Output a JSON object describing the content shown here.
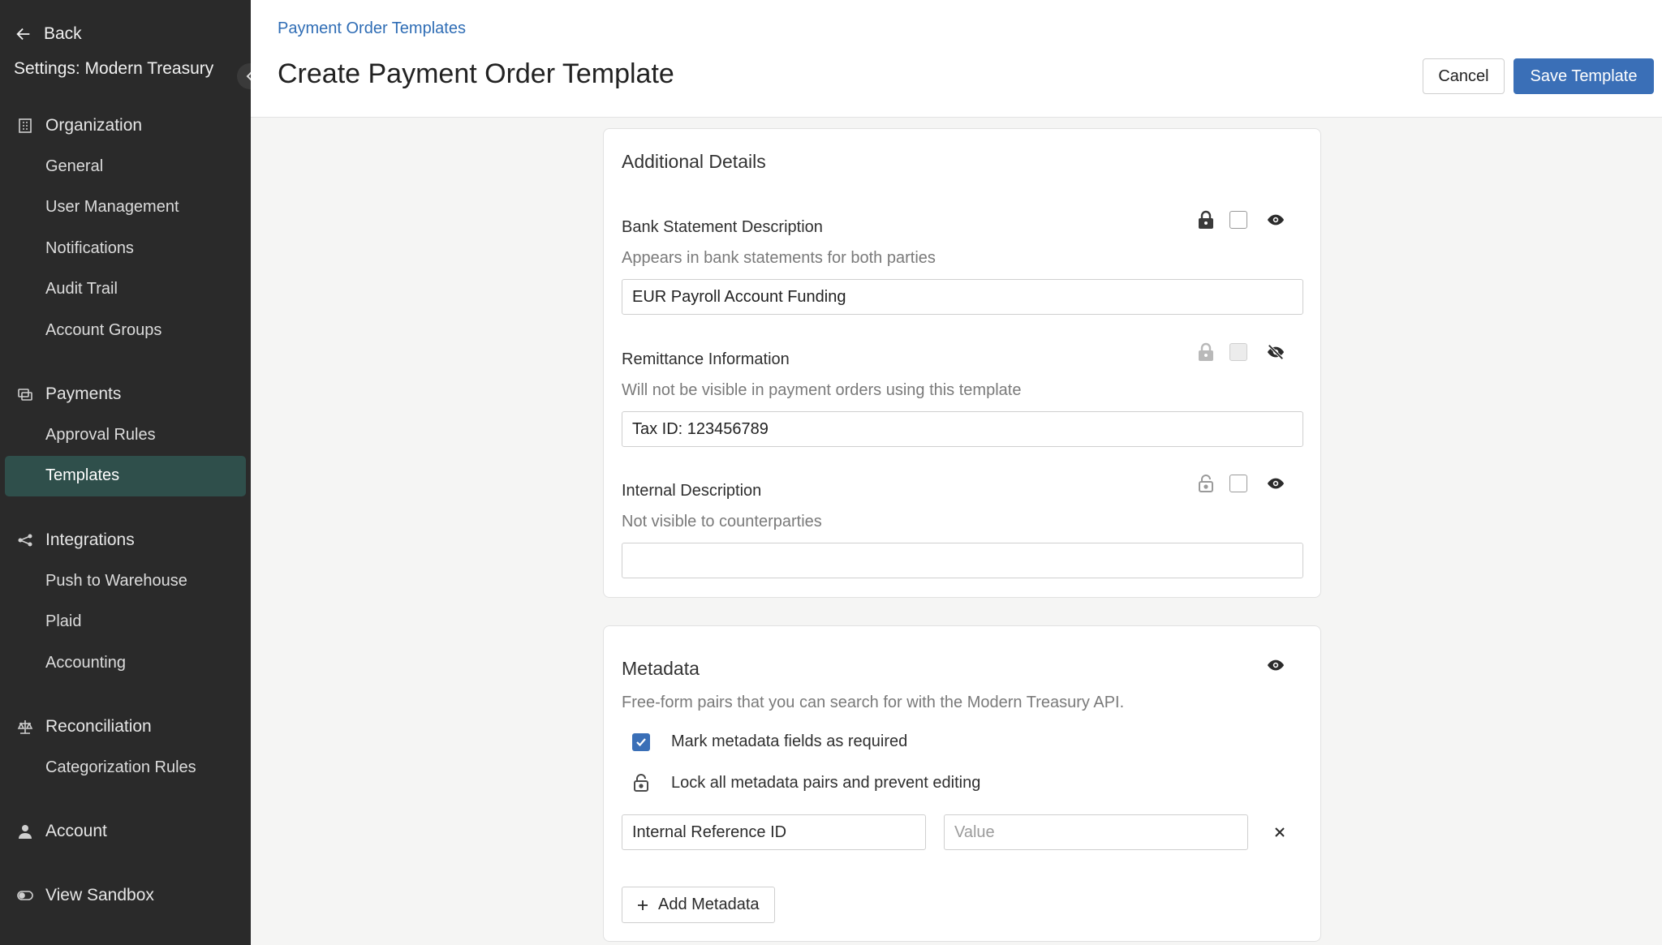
{
  "sidebar": {
    "back_label": "Back",
    "org_title": "Settings: Modern Treasury",
    "sections": {
      "organization": {
        "label": "Organization",
        "items": [
          "General",
          "User Management",
          "Notifications",
          "Audit Trail",
          "Account Groups"
        ]
      },
      "payments": {
        "label": "Payments",
        "items": [
          "Approval Rules",
          "Templates"
        ]
      },
      "integrations": {
        "label": "Integrations",
        "items": [
          "Push to Warehouse",
          "Plaid",
          "Accounting"
        ]
      },
      "reconciliation": {
        "label": "Reconciliation",
        "items": [
          "Categorization Rules"
        ]
      },
      "account": {
        "label": "Account"
      },
      "sandbox": {
        "label": "View Sandbox"
      }
    },
    "active_item": "Templates",
    "active_color": "#2f4f4b"
  },
  "header": {
    "breadcrumb": "Payment Order Templates",
    "title": "Create Payment Order Template",
    "cancel_label": "Cancel",
    "save_label": "Save Template",
    "primary_color": "#3a6fb7"
  },
  "additional_details": {
    "title": "Additional Details",
    "fields": [
      {
        "label": "Bank Statement Description",
        "help": "Appears in bank statements for both parties",
        "value": "EUR Payroll Account Funding",
        "lock_icon": "lock-icon",
        "visibility_icon": "eye-icon",
        "checked": false
      },
      {
        "label": "Remittance Information",
        "help": "Will not be visible in payment orders using this template",
        "value": "Tax ID: 123456789",
        "lock_icon": "lock-icon",
        "visibility_icon": "eye-off-icon",
        "checked": false,
        "disabled": true
      },
      {
        "label": "Internal Description",
        "help": "Not visible to counterparties",
        "value": "",
        "lock_icon": "lock-open-icon",
        "visibility_icon": "eye-icon",
        "checked": false
      }
    ]
  },
  "metadata": {
    "title": "Metadata",
    "help": "Free-form pairs that you can search for with the Modern Treasury API.",
    "required_label": "Mark metadata fields as required",
    "required_checked": true,
    "lock_label": "Lock all metadata pairs and prevent editing",
    "pair_key": "Internal Reference ID",
    "pair_value_placeholder": "Value",
    "add_label": "Add Metadata"
  }
}
